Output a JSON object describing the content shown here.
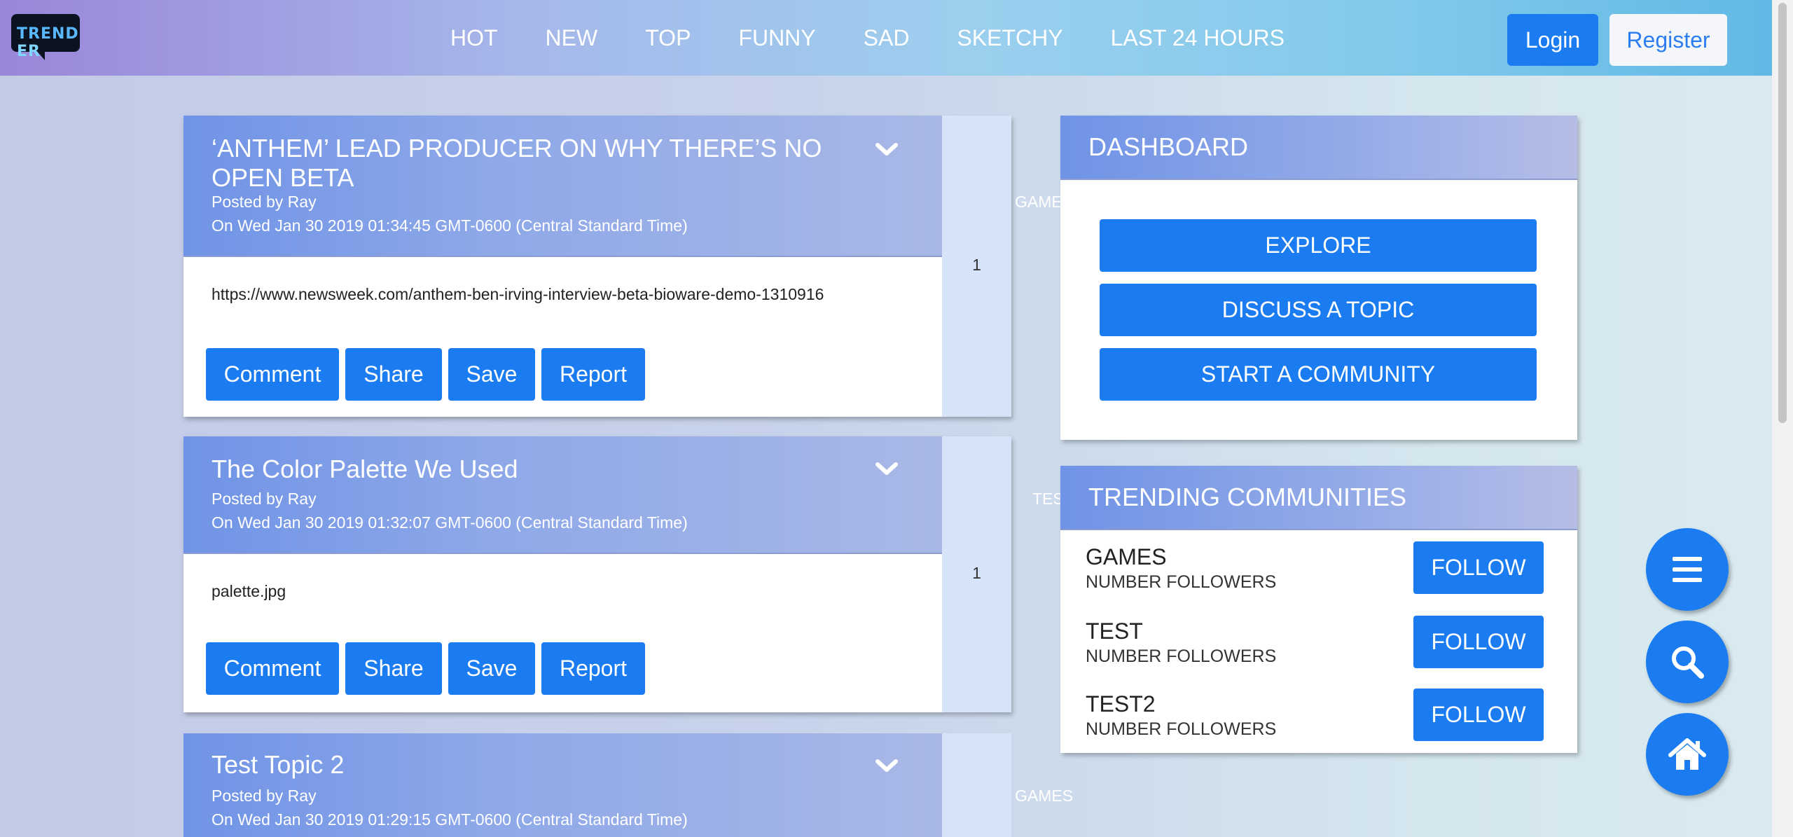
{
  "app": {
    "logo_part1": "TREND",
    "logo_part2": "ER"
  },
  "nav": {
    "links": [
      "HOT",
      "NEW",
      "TOP",
      "FUNNY",
      "SAD",
      "SKETCHY",
      "LAST 24 HOURS"
    ]
  },
  "auth": {
    "login_label": "Login",
    "register_label": "Register"
  },
  "posts": [
    {
      "title": "‘ANTHEM’ LEAD PRODUCER ON WHY THERE’S NO OPEN BETA",
      "posted_by": "Posted by Ray",
      "date": "On Wed Jan 30 2019 01:34:45 GMT-0600 (Central Standard Time)",
      "community": "GAMES",
      "content": "https://www.newsweek.com/anthem-ben-irving-interview-beta-bioware-demo-1310916",
      "votes": "1"
    },
    {
      "title": "The Color Palette We Used",
      "posted_by": "Posted by Ray",
      "date": "On Wed Jan 30 2019 01:32:07 GMT-0600 (Central Standard Time)",
      "community": "TEST",
      "content": "palette.jpg",
      "votes": "1"
    },
    {
      "title": "Test Topic 2",
      "posted_by": "Posted by Ray",
      "date": "On Wed Jan 30 2019 01:29:15 GMT-0600 (Central Standard Time)",
      "community": "GAMES"
    }
  ],
  "post_actions": {
    "comment": "Comment",
    "share": "Share",
    "save": "Save",
    "report": "Report"
  },
  "dashboard": {
    "title": "DASHBOARD",
    "explore": "EXPLORE",
    "discuss": "DISCUSS A TOPIC",
    "start": "START A COMMUNITY"
  },
  "trending": {
    "title": "TRENDING COMMUNITIES",
    "follow_label": "FOLLOW",
    "items": [
      {
        "name": "GAMES",
        "sub": "NUMBER FOLLOWERS"
      },
      {
        "name": "TEST",
        "sub": "NUMBER FOLLOWERS"
      },
      {
        "name": "TEST2",
        "sub": "NUMBER FOLLOWERS"
      }
    ]
  },
  "fab": {
    "icons": [
      "menu-icon",
      "search-icon",
      "home-icon"
    ]
  },
  "colors": {
    "primary": "#1a7cf0",
    "vote_bg": "#d5e4f8"
  }
}
